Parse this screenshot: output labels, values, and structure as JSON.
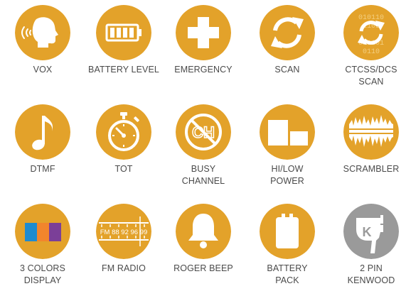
{
  "colors": {
    "accent": "#e3a22a",
    "grey_badge": "#9a9a9a",
    "icon_foreground": "#ffffff",
    "label_text": "#4a4a4a",
    "display_palette": [
      "#1e8bd0",
      "#f2852c",
      "#7b3f98"
    ]
  },
  "features": [
    {
      "label": "VOX",
      "icon": "speaking-head-icon"
    },
    {
      "label": "BATTERY LEVEL",
      "icon": "battery-level-icon"
    },
    {
      "label": "EMERGENCY",
      "icon": "medical-cross-icon"
    },
    {
      "label": "SCAN",
      "icon": "refresh-arrows-icon"
    },
    {
      "label": "CTCSS/DCS\nSCAN",
      "icon": "binary-refresh-icon",
      "icon_text": "010110 1101 011101 0110"
    },
    {
      "label": "DTMF",
      "icon": "music-note-icon"
    },
    {
      "label": "TOT",
      "icon": "stopwatch-icon"
    },
    {
      "label": "BUSY\nCHANNEL",
      "icon": "channel-prohibited-icon",
      "icon_text": "CH"
    },
    {
      "label": "HI/LOW\nPOWER",
      "icon": "power-blocks-icon"
    },
    {
      "label": "SCRAMBLER",
      "icon": "waveform-icon"
    },
    {
      "label": "3 COLORS\nDISPLAY",
      "icon": "color-bars-icon"
    },
    {
      "label": "FM RADIO",
      "icon": "radio-dial-icon",
      "icon_text": "FM 88 92 96 99"
    },
    {
      "label": "ROGER BEEP",
      "icon": "bell-icon"
    },
    {
      "label": "BATTERY\nPACK",
      "icon": "battery-pack-icon"
    },
    {
      "label": "2 PIN\nKENWOOD",
      "icon": "connector-plug-icon",
      "icon_text": "K"
    }
  ]
}
